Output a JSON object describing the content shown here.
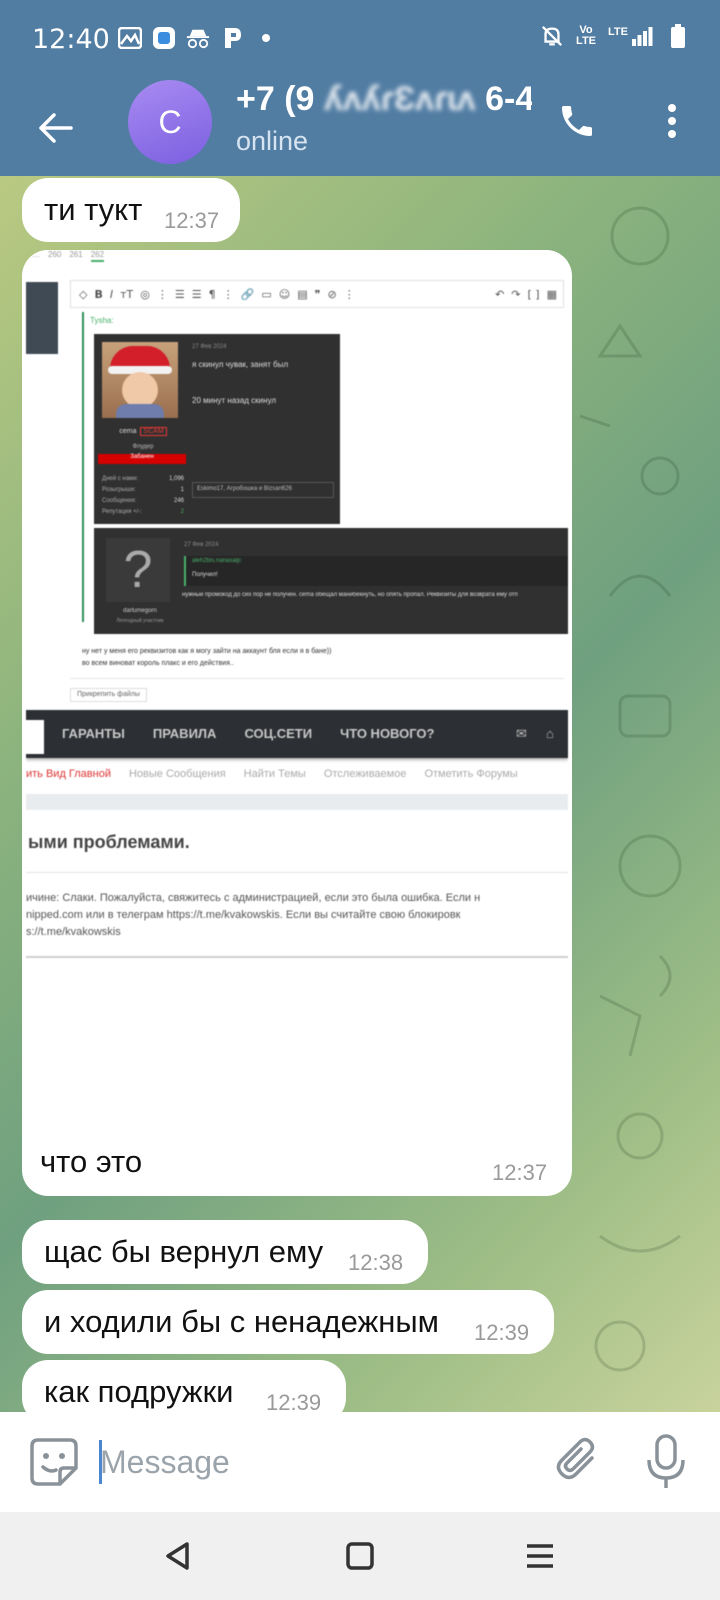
{
  "status_bar": {
    "time": "12:40",
    "lte_label": "LTE",
    "volte_label": "Vo LTE",
    "icons": [
      "gallery-icon",
      "app-icon",
      "incognito-icon",
      "p-icon",
      "dot-icon",
      "bell-off-icon",
      "volte-icon",
      "signal-icon",
      "battery-icon"
    ]
  },
  "header": {
    "avatar_letter": "C",
    "contact_name_prefix": "+7 (9",
    "contact_name_suffix": "6-4",
    "status": "online",
    "accent": "#527da3"
  },
  "messages": [
    {
      "text": "ти тукт",
      "time": "12:37"
    },
    {
      "caption": "что это",
      "time": "12:37"
    },
    {
      "text": "щас бы вернул ему",
      "time": "12:38"
    },
    {
      "text": "и ходили бы с ненадежным",
      "time": "12:39"
    },
    {
      "text": "как подружки",
      "time": "12:39"
    }
  ],
  "screenshot": {
    "pages": [
      "…",
      "260",
      "261",
      "262"
    ],
    "quote_author": "Tysha:",
    "post1": {
      "date": "27 Фев 2024",
      "text1": "я скинул чувак, занят был",
      "text2": "20 минут назад скинул",
      "username": "cema",
      "scam_badge": "SCAM",
      "role": "Флудер",
      "banned": "Забанен",
      "stats": [
        {
          "label": "Дней с нами:",
          "value": "1,096"
        },
        {
          "label": "Розыгрыши:",
          "value": "1"
        },
        {
          "label": "Сообщения:",
          "value": "246"
        },
        {
          "label": "Репутация +/-:",
          "value": "2"
        }
      ],
      "reactions": "Eskimo17, Агробошка и Bizsan626"
    },
    "post2": {
      "date": "27 Фев 2024",
      "quote_author": "aleh2bis.nanasaip:",
      "quote_text": "Получил!",
      "text": "нужный промокод до сих пор не получен. cema обещал манибекнуть, но опять пропал. Реквизиты для возврата ему отп",
      "username": "darlumegorn",
      "role": "Легендный участник"
    },
    "editor_text1": "ну нет у меня его реквизитов как я могу зайти на аккаунт бля если я в бане))",
    "editor_text2": "во всем виноват король плакс и его действия..",
    "attach_label": "Прикрепить файлы",
    "nav_items": [
      "ГАРАНТЫ",
      "ПРАВИЛА",
      "СОЦ.СЕТИ",
      "ЧТО НОВОГО?"
    ],
    "subnav_items": [
      "ить Вид Главной",
      "Новые Сообщения",
      "Найти Темы",
      "Отслеживаемое",
      "Отметить Форумы"
    ],
    "page_heading": "ыми проблемами.",
    "ban_line1": "ичине: Слаки. Пожалуйста, свяжитесь с администрацией, если это была ошибка. Если н",
    "ban_line2": "nipped.com или в телеграм https://t.me/kvakowskis. Если вы считайте свою блокировк",
    "ban_line3": "s://t.me/kvakowskis"
  },
  "input": {
    "placeholder": "Message"
  }
}
